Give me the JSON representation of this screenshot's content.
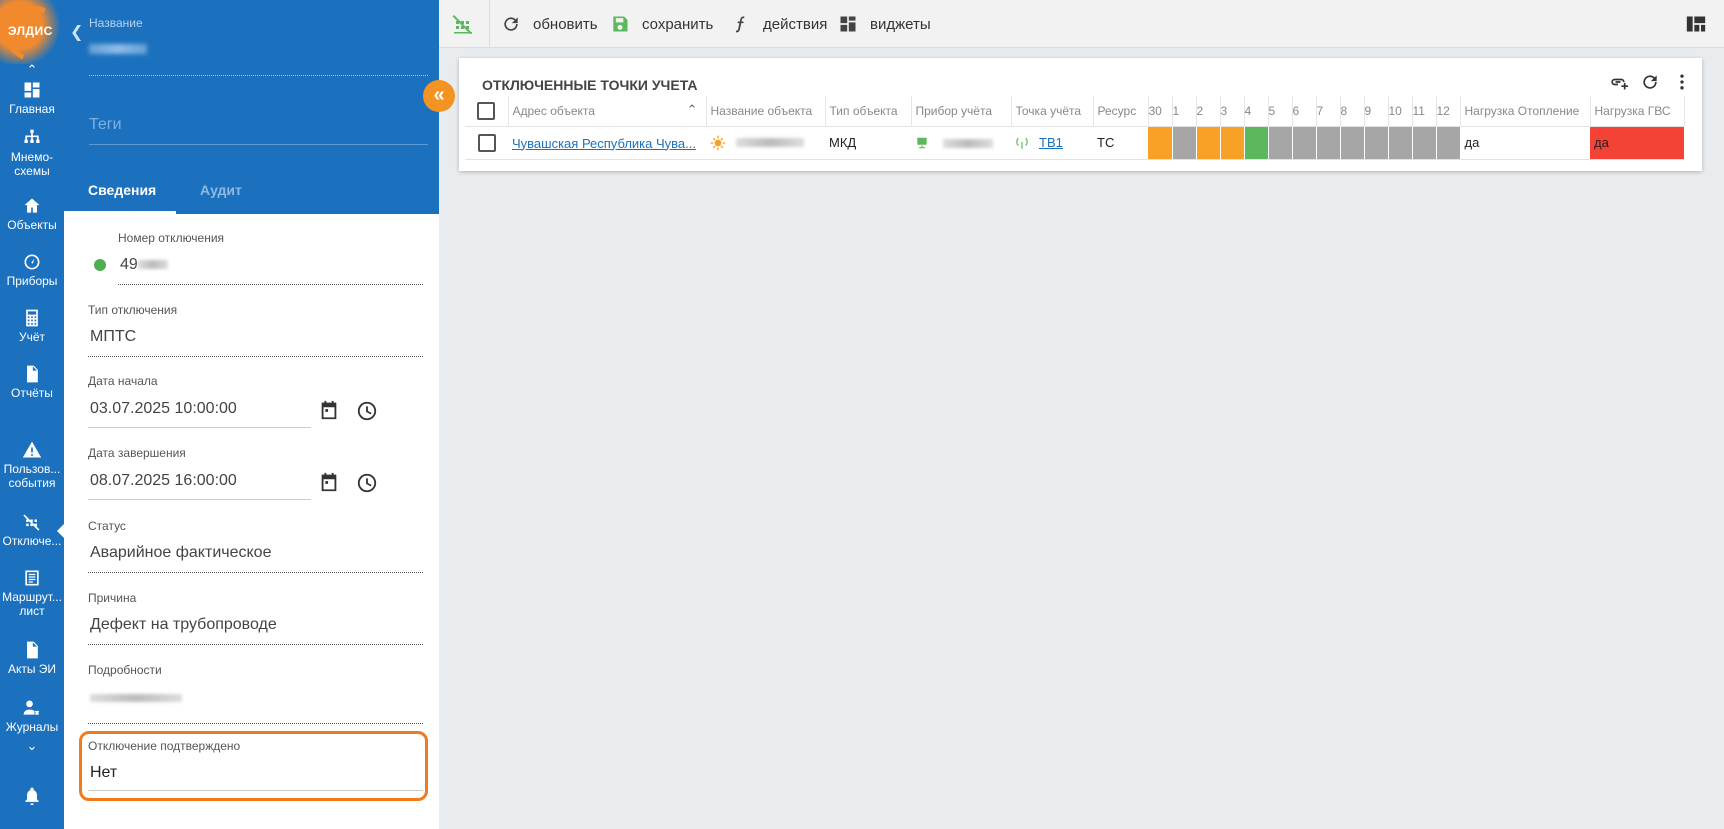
{
  "nav": {
    "logo_text": "ЭЛДИС",
    "items": [
      {
        "label": "Главная",
        "icon": "dashboard-icon"
      },
      {
        "label": "Мнемо-схемы",
        "icon": "hierarchy-icon"
      },
      {
        "label": "Объекты",
        "icon": "home-icon"
      },
      {
        "label": "Приборы",
        "icon": "gauge-icon"
      },
      {
        "label": "Учёт",
        "icon": "calculator-icon"
      },
      {
        "label": "Отчёты",
        "icon": "document-icon"
      },
      {
        "label": "Пользов... события",
        "icon": "warning-icon"
      },
      {
        "label": "Отключе...",
        "icon": "disconnect-icon"
      },
      {
        "label": "Маршрут... лист",
        "icon": "list-icon"
      },
      {
        "label": "Акты ЭИ",
        "icon": "file-icon"
      },
      {
        "label": "Журналы",
        "icon": "user-gear-icon"
      }
    ]
  },
  "panel": {
    "name_label": "Название",
    "tags_placeholder": "Теги",
    "tabs": [
      "Сведения",
      "Аудит"
    ],
    "fields": {
      "number_label": "Номер отключения",
      "number_value": "49",
      "type_label": "Тип отключения",
      "type_value": "МПТС",
      "start_label": "Дата начала",
      "start_value": "03.07.2025 10:00:00",
      "end_label": "Дата завершения",
      "end_value": "08.07.2025 16:00:00",
      "status_label": "Статус",
      "status_value": "Аварийное фактическое",
      "reason_label": "Причина",
      "reason_value": "Дефект на трубопроводе",
      "details_label": "Подробности",
      "confirmed_label": "Отключение подтверждено",
      "confirmed_value": "Нет"
    },
    "status_color": "#4caf50"
  },
  "toolbar": {
    "refresh": "обновить",
    "save": "сохранить",
    "actions": "действия",
    "widgets": "виджеты"
  },
  "widget": {
    "title": "ОТКЛЮЧЕННЫЕ ТОЧКИ УЧЕТА",
    "columns": {
      "address": "Адрес объекта",
      "name": "Название объекта",
      "type": "Тип объекта",
      "device": "Прибор учёта",
      "point": "Точка учёта",
      "resource": "Ресурс",
      "days": [
        "30",
        "1",
        "2",
        "3",
        "4",
        "5",
        "6",
        "7",
        "8",
        "9",
        "10",
        "11",
        "12"
      ],
      "heating": "Нагрузка Отопление",
      "hot_water": "Нагрузка ГВС"
    },
    "rows": [
      {
        "address": "Чувашская Республика Чува...",
        "type": "МКД",
        "point": "ТВ1",
        "resource": "ТС",
        "day_status": [
          "orange",
          "gray",
          "orange",
          "orange",
          "green",
          "gray",
          "gray",
          "gray",
          "gray",
          "gray",
          "gray",
          "gray",
          "gray"
        ],
        "heating": "да",
        "hot_water": "да"
      }
    ],
    "colors": {
      "orange": "#f7a128",
      "gray": "#a6a6a6",
      "green": "#5cb85c",
      "red": "#f44336"
    }
  }
}
